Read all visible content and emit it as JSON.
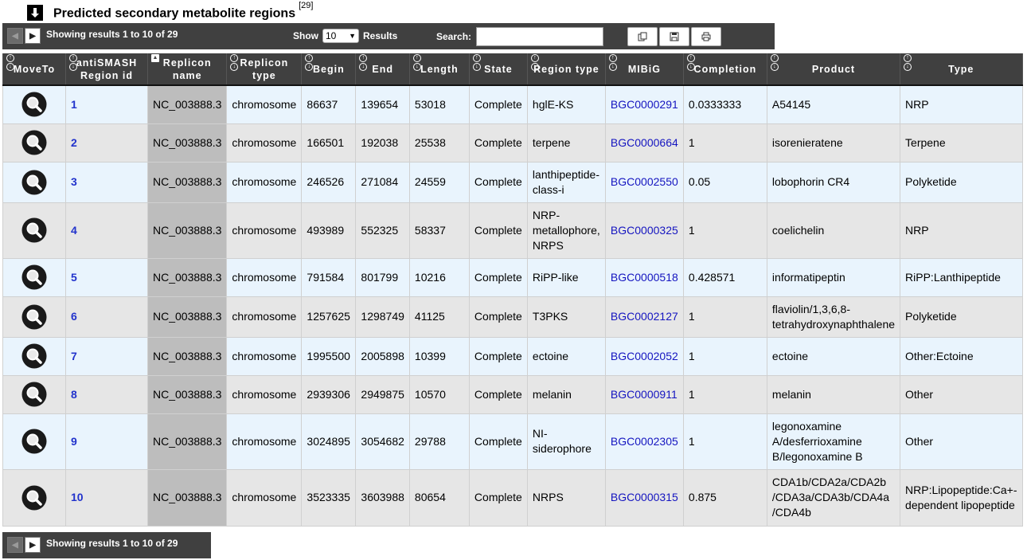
{
  "title": {
    "text": "Predicted secondary metabolite regions",
    "sup": "[29]"
  },
  "toolbar": {
    "info": "Showing results 1 to 10 of 29",
    "show_label": "Show",
    "show_value": "10",
    "results_label": "Results",
    "search_label": "Search:",
    "search_value": "",
    "copy_icon": "copy-icon",
    "save_icon": "save-icon",
    "print_icon": "print-icon"
  },
  "footer": {
    "info": "Showing results 1 to 10 of 29"
  },
  "columns": [
    "MoveTo",
    "antiSMASH Region id",
    "Replicon name",
    "Replicon type",
    "Begin",
    "End",
    "Length",
    "State",
    "Region type",
    "MIBiG",
    "Completion",
    "Product",
    "Type"
  ],
  "rows": [
    {
      "id": "1",
      "replicon": "NC_003888.3",
      "rtype": "chromosome",
      "begin": "86637",
      "end": "139654",
      "length": "53018",
      "state": "Complete",
      "region": "hglE-KS",
      "mibig": "BGC0000291",
      "completion": "0.0333333",
      "product": "A54145",
      "type": "NRP"
    },
    {
      "id": "2",
      "replicon": "NC_003888.3",
      "rtype": "chromosome",
      "begin": "166501",
      "end": "192038",
      "length": "25538",
      "state": "Complete",
      "region": "terpene",
      "mibig": "BGC0000664",
      "completion": "1",
      "product": "isorenieratene",
      "type": "Terpene"
    },
    {
      "id": "3",
      "replicon": "NC_003888.3",
      "rtype": "chromosome",
      "begin": "246526",
      "end": "271084",
      "length": "24559",
      "state": "Complete",
      "region": "lanthipeptide-class-i",
      "mibig": "BGC0002550",
      "completion": "0.05",
      "product": "lobophorin CR4",
      "type": "Polyketide"
    },
    {
      "id": "4",
      "replicon": "NC_003888.3",
      "rtype": "chromosome",
      "begin": "493989",
      "end": "552325",
      "length": "58337",
      "state": "Complete",
      "region": "NRP-metallophore, NRPS",
      "mibig": "BGC0000325",
      "completion": "1",
      "product": "coelichelin",
      "type": "NRP"
    },
    {
      "id": "5",
      "replicon": "NC_003888.3",
      "rtype": "chromosome",
      "begin": "791584",
      "end": "801799",
      "length": "10216",
      "state": "Complete",
      "region": "RiPP-like",
      "mibig": "BGC0000518",
      "completion": "0.428571",
      "product": "informatipeptin",
      "type": "RiPP:Lanthipeptide"
    },
    {
      "id": "6",
      "replicon": "NC_003888.3",
      "rtype": "chromosome",
      "begin": "1257625",
      "end": "1298749",
      "length": "41125",
      "state": "Complete",
      "region": "T3PKS",
      "mibig": "BGC0002127",
      "completion": "1",
      "product": "flaviolin/1,3,6,8-tetrahydroxynaphthalene",
      "type": "Polyketide"
    },
    {
      "id": "7",
      "replicon": "NC_003888.3",
      "rtype": "chromosome",
      "begin": "1995500",
      "end": "2005898",
      "length": "10399",
      "state": "Complete",
      "region": "ectoine",
      "mibig": "BGC0002052",
      "completion": "1",
      "product": "ectoine",
      "type": "Other:Ectoine"
    },
    {
      "id": "8",
      "replicon": "NC_003888.3",
      "rtype": "chromosome",
      "begin": "2939306",
      "end": "2949875",
      "length": "10570",
      "state": "Complete",
      "region": "melanin",
      "mibig": "BGC0000911",
      "completion": "1",
      "product": "melanin",
      "type": "Other"
    },
    {
      "id": "9",
      "replicon": "NC_003888.3",
      "rtype": "chromosome",
      "begin": "3024895",
      "end": "3054682",
      "length": "29788",
      "state": "Complete",
      "region": "NI-siderophore",
      "mibig": "BGC0002305",
      "completion": "1",
      "product": "legonoxamine A/desferrioxamine B/legonoxamine B",
      "type": "Other"
    },
    {
      "id": "10",
      "replicon": "NC_003888.3",
      "rtype": "chromosome",
      "begin": "3523335",
      "end": "3603988",
      "length": "80654",
      "state": "Complete",
      "region": "NRPS",
      "mibig": "BGC0000315",
      "completion": "0.875",
      "product": "CDA1b/CDA2a/CDA2b /CDA3a/CDA3b/CDA4a /CDA4b",
      "type": "NRP:Lipopeptide:Ca+-dependent lipopeptide"
    }
  ]
}
